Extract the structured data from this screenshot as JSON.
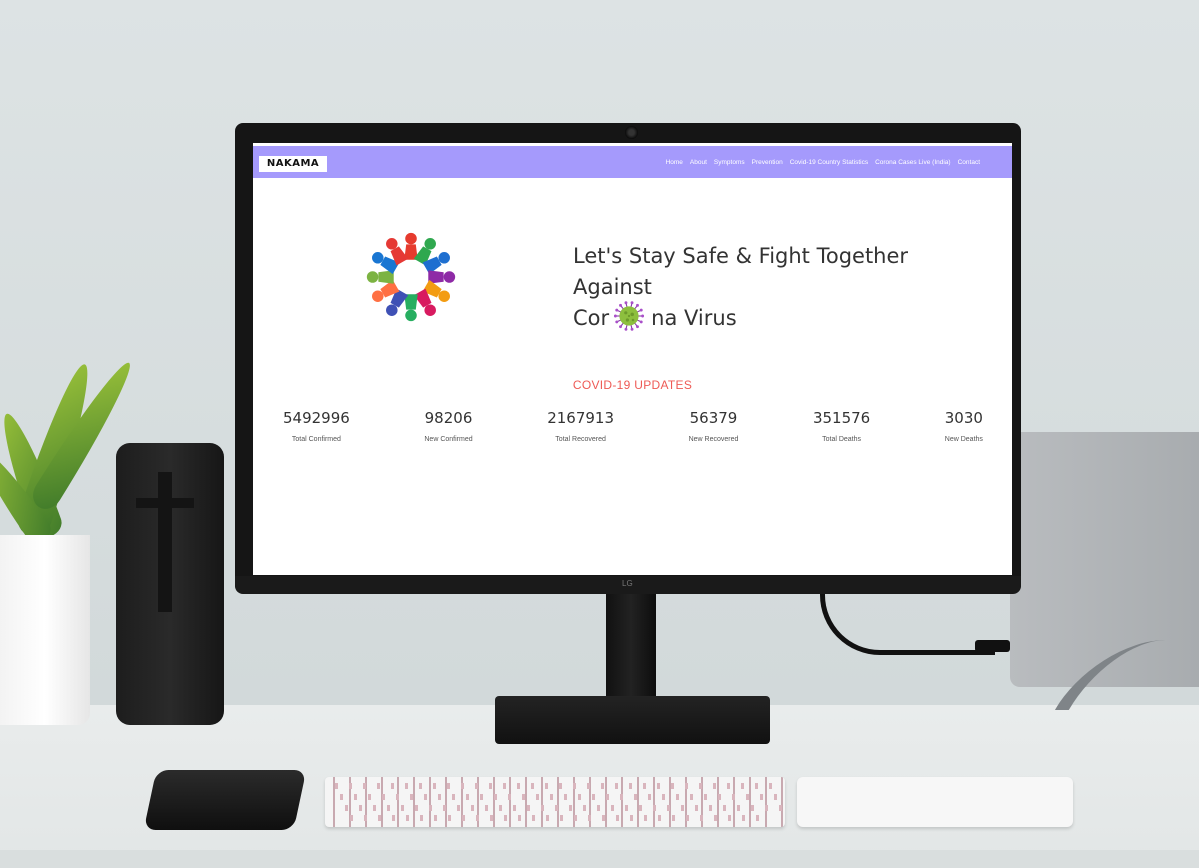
{
  "brand": {
    "name": "NAKAMA"
  },
  "nav": {
    "items": [
      {
        "label": "Home"
      },
      {
        "label": "About"
      },
      {
        "label": "Symptoms"
      },
      {
        "label": "Prevention"
      },
      {
        "label": "Covid-19 Country Statistics"
      },
      {
        "label": "Corona Cases Live (India)"
      },
      {
        "label": "Contact"
      }
    ]
  },
  "hero": {
    "title_line1": "Let's Stay Safe & Fight Together Against",
    "title_prefix": "Cor",
    "title_suffix": "na Virus",
    "logo_icon": "people-circle-icon",
    "virus_icon": "virus-icon"
  },
  "updates": {
    "heading": "COVID-19 UPDATES",
    "stats": [
      {
        "value": "5492996",
        "label": "Total Confirmed"
      },
      {
        "value": "98206",
        "label": "New Confirmed"
      },
      {
        "value": "2167913",
        "label": "Total Recovered"
      },
      {
        "value": "56379",
        "label": "New Recovered"
      },
      {
        "value": "351576",
        "label": "Total Deaths"
      },
      {
        "value": "3030",
        "label": "New Deaths"
      }
    ]
  },
  "monitor": {
    "logo": "LG"
  },
  "colors": {
    "navbar": "#a59afc",
    "accent": "#ee5a55"
  }
}
